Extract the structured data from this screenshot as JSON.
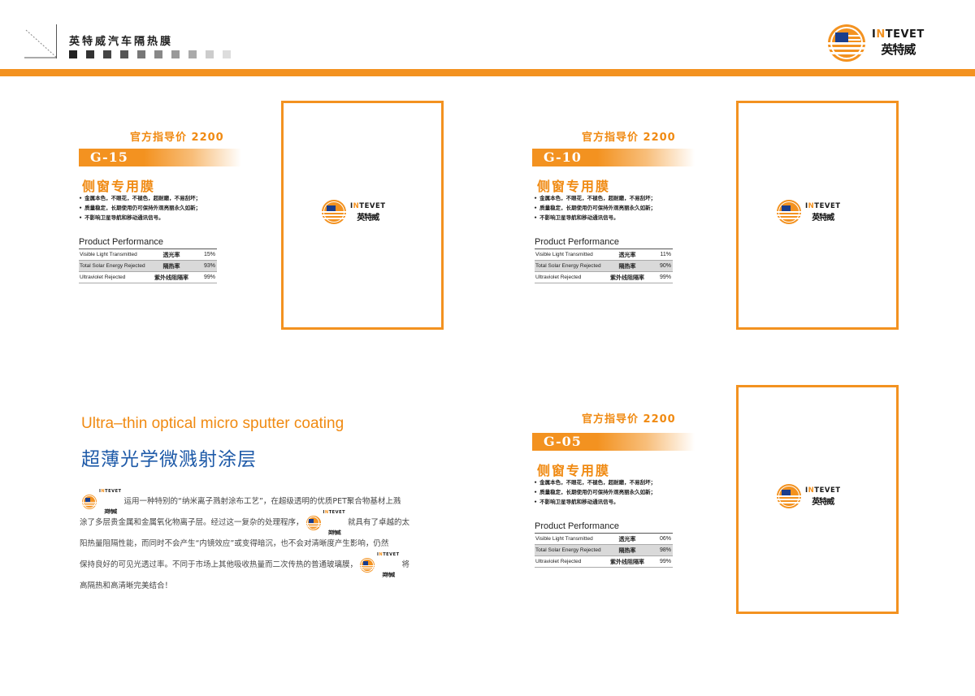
{
  "header": {
    "title": "英特威汽车隔热膜",
    "squares": [
      "#222222",
      "#333333",
      "#444444",
      "#555555",
      "#777777",
      "#888888",
      "#999999",
      "#aaaaaa",
      "#cccccc",
      "#dddddd"
    ],
    "bar_color": "#f39220"
  },
  "brand": {
    "en_a": "I",
    "en_o": "N",
    "en_b": "TEVET",
    "cn": "英特威",
    "accent": "#f39220",
    "blue": "#1a3d8c"
  },
  "products": [
    {
      "price": "官方指导价 2200",
      "model": "G-15",
      "type": "侧窗专用膜",
      "features": [
        "金属本色，不眼花，不褪色，超耐磨，不易刮坏；",
        "质量稳定，长期使用仍可保持外观亮丽永久如新；",
        "不影响卫星导航和移动通讯信号。"
      ],
      "performance_title": "Product Performance",
      "rows": [
        {
          "en": "Visible Light Transmitted",
          "cn": "透光率",
          "val": "15%"
        },
        {
          "en": "Total Solar Energy Rejected",
          "cn": "隔热率",
          "val": "93%"
        },
        {
          "en": "Ultraviolet Rejected",
          "cn": "紫外线阻隔率",
          "val": "99%"
        }
      ]
    },
    {
      "price": "官方指导价 2200",
      "model": "G-10",
      "type": "侧窗专用膜",
      "features": [
        "金属本色，不眼花，不褪色，超耐磨，不易刮坏；",
        "质量稳定，长期使用仍可保持外观亮丽永久如新；",
        "不影响卫星导航和移动通讯信号。"
      ],
      "performance_title": "Product Performance",
      "rows": [
        {
          "en": "Visible Light Transmitted",
          "cn": "透光率",
          "val": "11%"
        },
        {
          "en": "Total Solar Energy Rejected",
          "cn": "隔热率",
          "val": "90%"
        },
        {
          "en": "Ultraviolet Rejected",
          "cn": "紫外线阻隔率",
          "val": "99%"
        }
      ]
    },
    {
      "price": "官方指导价 2200",
      "model": "G-05",
      "type": "侧窗专用膜",
      "features": [
        "金属本色，不眼花，不褪色，超耐磨，不易刮坏；",
        "质量稳定，长期使用仍可保持外观亮丽永久如新；",
        "不影响卫星导航和移动通讯信号。"
      ],
      "performance_title": "Product Performance",
      "rows": [
        {
          "en": "Visible Light Transmitted",
          "cn": "透光率",
          "val": "06%"
        },
        {
          "en": "Total Solar Energy Rejected",
          "cn": "隔热率",
          "val": "98%"
        },
        {
          "en": "Ultraviolet Rejected",
          "cn": "紫外线阻隔率",
          "val": "99%"
        }
      ]
    }
  ],
  "feature_section": {
    "en_heading": "Ultra–thin optical micro sputter coating",
    "cn_heading": "超薄光学微溅射涂层",
    "lines": [
      {
        "before": "",
        "after": "运用一种特别的“纳米离子溅射涂布工艺”，在超级透明的优质PET聚合物基材上溅"
      },
      {
        "before": "涂了多层贵金属和金属氧化物离子层。经过这一复杂的处理程序，",
        "after": "就具有了卓越的太"
      },
      {
        "before": "阳热量阻隔性能，而同时不会产生“内镜效应”或变得暗沉，也不会对清晰度产生影响，仍然",
        "after": ""
      },
      {
        "before": "保持良好的可见光透过率。不同于市场上其他吸收热量而二次传热的普通玻璃膜，",
        "after": "将"
      },
      {
        "before": "高隔热和高清晰完美结合！",
        "after": ""
      }
    ]
  }
}
